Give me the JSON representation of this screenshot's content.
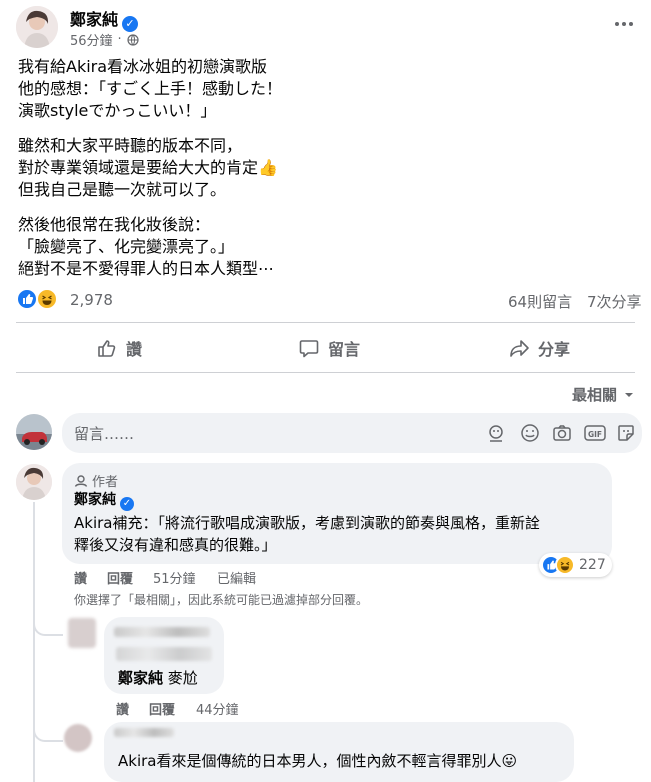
{
  "post": {
    "author_name": "鄭家純",
    "time": "56分鐘",
    "privacy_icon": "public-globe-icon",
    "more_icon": "more-horizontal-icon",
    "lines": [
      "我有給Akira看冰冰姐的初戀演歌版",
      "他的感想：「すごく上手！感動した！",
      "演歌styleでかっこいい！」",
      "雖然和大家平時聽的版本不同，",
      "對於專業領域還是要給大大的肯定👍",
      "但我自己是聽一次就可以了。",
      "然後他很常在我化妝後說：",
      "「臉變亮了、化完變漂亮了。」",
      "絕對不是不愛得罪人的日本人類型⋯"
    ],
    "reaction_count": "2,978",
    "comment_count": "64則留言",
    "share_count": "7次分享",
    "reaction_icons": [
      "like-icon",
      "haha-icon"
    ]
  },
  "actions": {
    "like": "讚",
    "comment": "留言",
    "share": "分享"
  },
  "sort": {
    "label": "最相關"
  },
  "composer": {
    "placeholder": "留言……",
    "tools": [
      "avatar-sticker-icon",
      "emoji-icon",
      "camera-icon",
      "gif-icon",
      "sticker-icon"
    ]
  },
  "comments": [
    {
      "badge": "作者",
      "author": "鄭家純",
      "text_line1": "Akira補充：「將流行歌唱成演歌版，考慮到演歌的節奏與風格，重新詮",
      "text_line2": "釋後又沒有違和感真的很難。」",
      "like_label": "讚",
      "reply_label": "回覆",
      "time": "51分鐘",
      "edited": "已編輯",
      "reaction_count": "227",
      "filter_note": "你選擇了「最相關」，因此系統可能已過濾掉部分回覆。"
    },
    {
      "author": "鄭家純",
      "text": "麥尬",
      "like_label": "讚",
      "reply_label": "回覆",
      "time": "44分鐘"
    },
    {
      "text": "Akira看來是個傳統的日本男人，個性內斂不輕言得罪別人😛"
    }
  ]
}
